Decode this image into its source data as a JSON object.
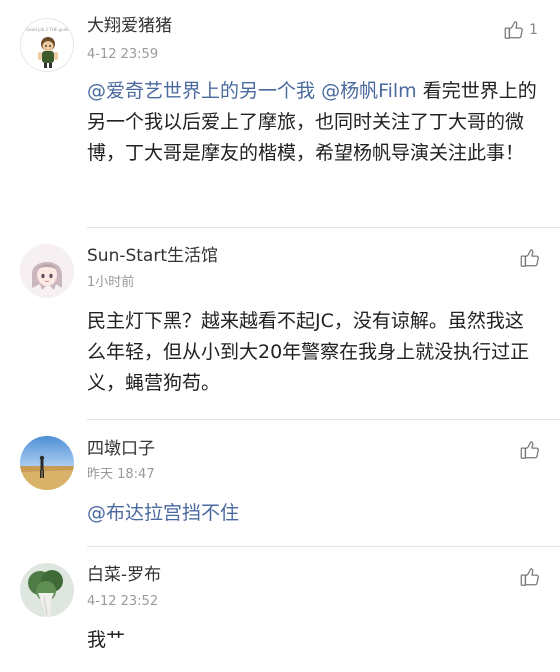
{
  "comments": [
    {
      "username": "大翔爱猪猪",
      "time": "4-12 23:59",
      "like_count": "1",
      "avatar_text": "Good job 2 THE guide",
      "text_parts": [
        {
          "text": "@爱奇艺世界上的另一个我",
          "mention": true
        },
        {
          "text": " ",
          "mention": false
        },
        {
          "text": "@杨帆Film",
          "mention": true
        },
        {
          "text": " 看完世界上的另一个我以后爱上了摩旅，也同时关注了丁大哥的微博，丁大哥是摩友的楷模，希望杨帆导演关注此事！",
          "mention": false
        }
      ]
    },
    {
      "username": "Sun-Start生活馆",
      "time": "1小时前",
      "like_count": "",
      "text_parts": [
        {
          "text": "民主灯下黑？越来越看不起JC，没有谅解。虽然我这么年轻，但从小到大20年警察在我身上就没执行过正义，蝇营狗苟。",
          "mention": false
        }
      ]
    },
    {
      "username": "四墩口子",
      "time": "昨天 18:47",
      "like_count": "",
      "text_parts": [
        {
          "text": "@布达拉宫挡不住",
          "mention": true
        }
      ]
    },
    {
      "username": "白菜-罗布",
      "time": "4-12 23:52",
      "like_count": "",
      "text_parts": [
        {
          "text": "我艹",
          "mention": false
        }
      ]
    }
  ],
  "colors": {
    "mention": "#4a6a9f",
    "text": "#222222",
    "meta": "#9a9a9a",
    "divider": "#e2e2e2"
  },
  "icons": {
    "like": "thumbs-up-icon"
  }
}
